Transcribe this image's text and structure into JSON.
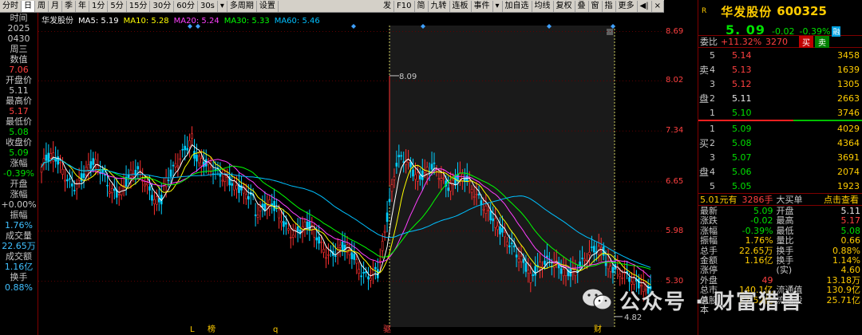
{
  "toolbar": {
    "left": [
      "分时",
      "日",
      "周",
      "月",
      "季",
      "年",
      "1分",
      "5分",
      "15分",
      "30分",
      "60分",
      "30s",
      "▾",
      "多周期",
      "设置"
    ],
    "right": [
      "发",
      "F10",
      "简",
      "九转",
      "连板",
      "事件",
      "▾",
      "加自选",
      "均线",
      "复权",
      "叠",
      "窗",
      "指",
      "更多",
      "◀|",
      "×"
    ]
  },
  "left_panel": [
    {
      "t": "时间",
      "c": "lbl"
    },
    {
      "t": "2025",
      "c": "lbl"
    },
    {
      "t": "0430",
      "c": "lbl"
    },
    {
      "t": "周三",
      "c": "lbl"
    },
    {
      "t": "数值",
      "c": "lbl"
    },
    {
      "t": "7.06",
      "c": "v-red"
    },
    {
      "t": "开盘价",
      "c": "lbl"
    },
    {
      "t": "5.11",
      "c": "lbl"
    },
    {
      "t": "最高价",
      "c": "lbl"
    },
    {
      "t": "5.17",
      "c": "v-red"
    },
    {
      "t": "最低价",
      "c": "lbl"
    },
    {
      "t": "5.08",
      "c": "v-green"
    },
    {
      "t": "收盘价",
      "c": "lbl"
    },
    {
      "t": "5.09",
      "c": "v-green"
    },
    {
      "t": "涨幅",
      "c": "lbl"
    },
    {
      "t": "-0.39%",
      "c": "v-green"
    },
    {
      "t": "开盘",
      "c": "lbl"
    },
    {
      "t": "涨幅",
      "c": "lbl"
    },
    {
      "t": "+0.00%",
      "c": "lbl"
    },
    {
      "t": "振幅",
      "c": "lbl"
    },
    {
      "t": "1.76%",
      "c": "v-cyan"
    },
    {
      "t": "成交量",
      "c": "lbl"
    },
    {
      "t": "22.65万",
      "c": "v-cyan"
    },
    {
      "t": "成交额",
      "c": "lbl"
    },
    {
      "t": "1.16亿",
      "c": "v-cyan"
    },
    {
      "t": "换手",
      "c": "lbl"
    },
    {
      "t": "0.88%",
      "c": "v-cyan"
    }
  ],
  "ma_legend": {
    "name": "华发股份",
    "items": [
      {
        "label": "MA5: 5.19",
        "color": "#ffffff"
      },
      {
        "label": "MA10: 5.28",
        "color": "#ffff00"
      },
      {
        "label": "MA20: 5.24",
        "color": "#ff40ff"
      },
      {
        "label": "MA30: 5.33",
        "color": "#00ff00"
      },
      {
        "label": "MA60: 5.46",
        "color": "#00c0ff"
      }
    ]
  },
  "chart_data": {
    "type": "candlestick",
    "y_ticks": [
      8.69,
      8.02,
      7.34,
      6.65,
      5.98,
      5.3
    ],
    "ylim": [
      4.7,
      8.75
    ],
    "annotations": [
      {
        "label": "8.09",
        "kind": "max"
      },
      {
        "label": "4.82",
        "kind": "min"
      }
    ],
    "bottom_markers": [
      "L",
      "榜",
      "q",
      "驱",
      "财"
    ],
    "colors": {
      "up": "#ff3030",
      "down": "#00d0ff",
      "ma5": "#ffffff",
      "ma10": "#ffff00",
      "ma20": "#ff40ff",
      "ma30": "#00ff00",
      "ma60": "#00c0ff",
      "axis": "#ff4040"
    }
  },
  "stock": {
    "flag": "R",
    "name": "华发股份",
    "code": "600325",
    "price": "5. 09",
    "change": "-0.02",
    "pct": "-0.39%",
    "tag": "融"
  },
  "weibi": {
    "k": "委比",
    "v1": "+11.32%",
    "v2": "3270",
    "sell": "买",
    "buy": "卖"
  },
  "asks": [
    {
      "lvl": "5",
      "price": "5.14",
      "vol": "3458",
      "c": "c-red"
    },
    {
      "lvl": "4",
      "price": "5.13",
      "vol": "1639",
      "c": "c-red"
    },
    {
      "lvl": "3",
      "price": "5.12",
      "vol": "1305",
      "c": "c-red"
    },
    {
      "lvl": "2",
      "price": "5.11",
      "vol": "2663",
      "c": "c-white"
    },
    {
      "lvl": "1",
      "price": "5.10",
      "vol": "3746",
      "c": "c-green"
    }
  ],
  "asks_side": [
    "卖",
    "盘"
  ],
  "bids": [
    {
      "lvl": "1",
      "price": "5.09",
      "vol": "4029",
      "c": "c-green"
    },
    {
      "lvl": "2",
      "price": "5.08",
      "vol": "4364",
      "c": "c-green"
    },
    {
      "lvl": "3",
      "price": "5.07",
      "vol": "3691",
      "c": "c-green"
    },
    {
      "lvl": "4",
      "price": "5.06",
      "vol": "2074",
      "c": "c-green"
    },
    {
      "lvl": "5",
      "price": "5.05",
      "vol": "1923",
      "c": "c-green"
    }
  ],
  "bids_side": [
    "买",
    "盘"
  ],
  "big_buy": {
    "a": "5.01元有",
    "b": "3286手",
    "c": "大买单",
    "d": "点击查看"
  },
  "quotes": [
    {
      "k": "最新",
      "v": "5.09",
      "vc": "green",
      "k2": "开盘",
      "v2": "5.11",
      "v2c": "white"
    },
    {
      "k": "涨跌",
      "v": "-0.02",
      "vc": "green",
      "k2": "最高",
      "v2": "5.17",
      "v2c": "red"
    },
    {
      "k": "涨幅",
      "v": "-0.39%",
      "vc": "green",
      "k2": "最低",
      "v2": "5.08",
      "v2c": "green"
    },
    {
      "k": "振幅",
      "v": "1.76%",
      "vc": "yellow",
      "k2": "量比",
      "v2": "0.66",
      "v2c": "yellow"
    },
    {
      "k": "总手",
      "v": "22.65万",
      "vc": "yellow",
      "k2": "换手",
      "v2": "0.88%",
      "v2c": "yellow"
    },
    {
      "k": "金额",
      "v": "1.16亿",
      "vc": "yellow",
      "k2": "换手(实)",
      "v2": "1.14%",
      "v2c": "yellow"
    },
    {
      "k": "涨停",
      "v": "",
      "vc": "red",
      "k2": "",
      "v2": "4.60",
      "v2c": "yellow"
    },
    {
      "k": "外盘",
      "v": "49",
      "vc": "red",
      "k2": "",
      "v2": "13.18万",
      "v2c": "yellow"
    },
    {
      "k": "总市值",
      "v": "140.1亿",
      "vc": "yellow",
      "k2": "流通值",
      "v2": "130.9亿",
      "v2c": "yellow"
    },
    {
      "k": "总股本",
      "v": "27.52亿",
      "vc": "yellow",
      "k2": "流通股",
      "v2": "25.71亿",
      "v2c": "yellow"
    }
  ],
  "watermark": {
    "text": "公众号 · 财富猎兽"
  }
}
